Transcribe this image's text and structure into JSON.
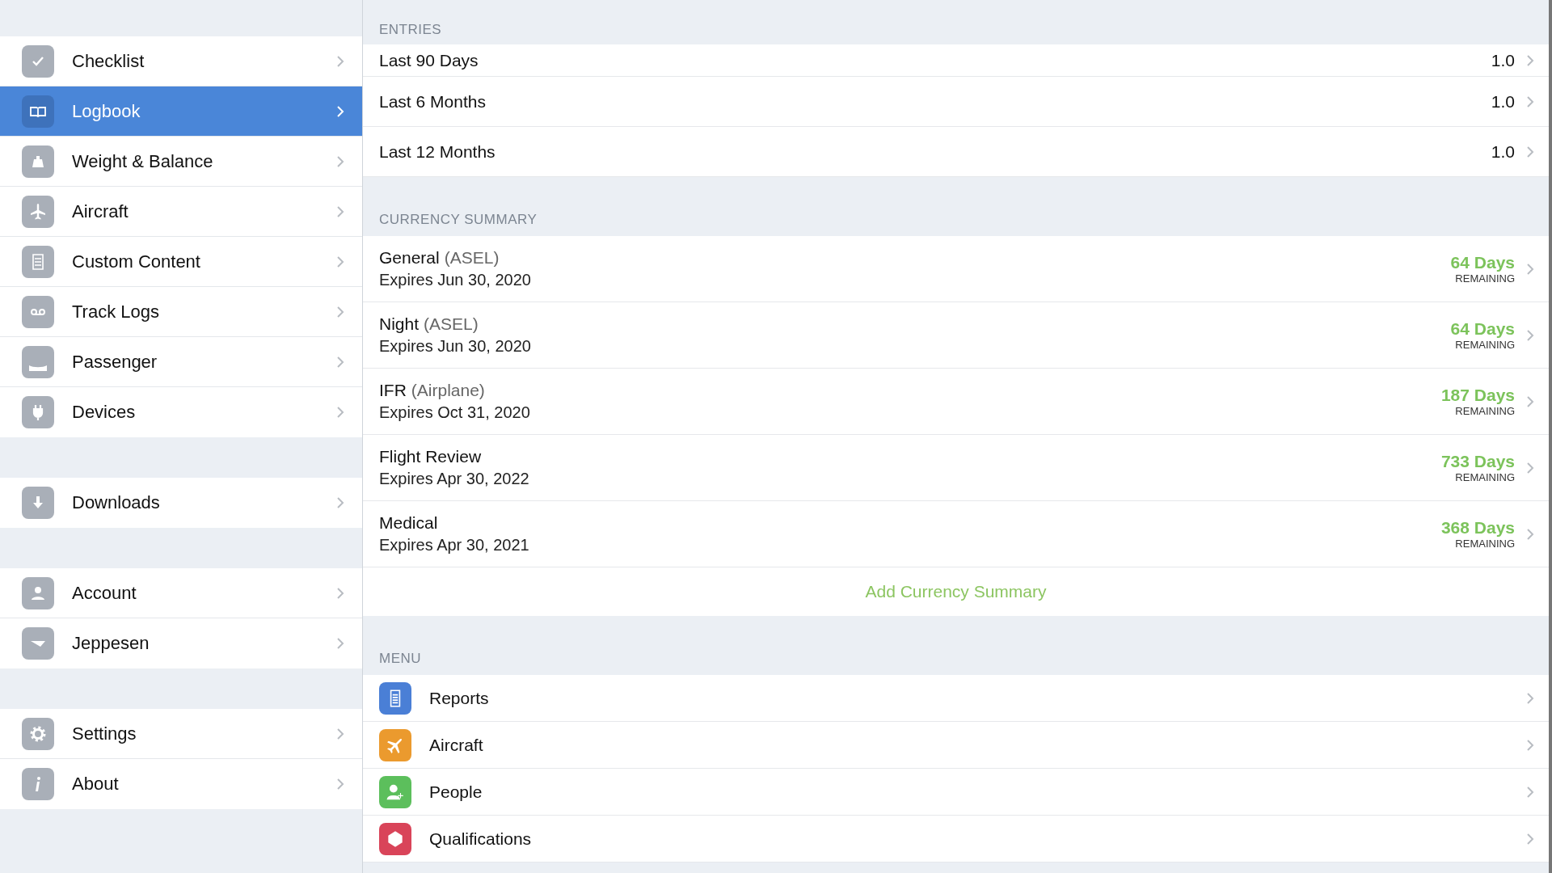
{
  "sidebar": {
    "groups": [
      {
        "items": [
          {
            "label": "Checklist",
            "selected": false
          },
          {
            "label": "Logbook",
            "selected": true
          },
          {
            "label": "Weight & Balance",
            "selected": false
          },
          {
            "label": "Aircraft",
            "selected": false
          },
          {
            "label": "Custom Content",
            "selected": false
          },
          {
            "label": "Track Logs",
            "selected": false
          },
          {
            "label": "Passenger",
            "selected": false
          },
          {
            "label": "Devices",
            "selected": false
          }
        ]
      },
      {
        "items": [
          {
            "label": "Downloads",
            "selected": false
          }
        ]
      },
      {
        "items": [
          {
            "label": "Account",
            "selected": false
          },
          {
            "label": "Jeppesen",
            "selected": false
          }
        ]
      },
      {
        "items": [
          {
            "label": "Settings",
            "selected": false
          },
          {
            "label": "About",
            "selected": false
          }
        ]
      }
    ]
  },
  "entries": {
    "header": "ENTRIES",
    "rows": [
      {
        "label": "Last 90 Days",
        "value": "1.0"
      },
      {
        "label": "Last 6 Months",
        "value": "1.0"
      },
      {
        "label": "Last 12 Months",
        "value": "1.0"
      }
    ]
  },
  "currency_summary": {
    "header": "CURRENCY SUMMARY",
    "rows": [
      {
        "name": "General",
        "qualifier": "(ASEL)",
        "expires": "Expires Jun 30, 2020",
        "days": "64 Days",
        "remaining": "REMAINING"
      },
      {
        "name": "Night",
        "qualifier": "(ASEL)",
        "expires": "Expires Jun 30, 2020",
        "days": "64 Days",
        "remaining": "REMAINING"
      },
      {
        "name": "IFR",
        "qualifier": "(Airplane)",
        "expires": "Expires Oct 31, 2020",
        "days": "187 Days",
        "remaining": "REMAINING"
      },
      {
        "name": "Flight Review",
        "expires": "Expires Apr 30, 2022",
        "days": "733 Days",
        "remaining": "REMAINING"
      },
      {
        "name": "Medical",
        "expires": "Expires Apr 30, 2021",
        "days": "368 Days",
        "remaining": "REMAINING"
      }
    ],
    "add_button": "Add Currency Summary"
  },
  "menu": {
    "header": "MENU",
    "items": [
      {
        "label": "Reports",
        "color": "#4a7fd6"
      },
      {
        "label": "Aircraft",
        "color": "#eb9a2e"
      },
      {
        "label": "People",
        "color": "#5cbf5c"
      },
      {
        "label": "Qualifications",
        "color": "#d94459"
      }
    ]
  }
}
